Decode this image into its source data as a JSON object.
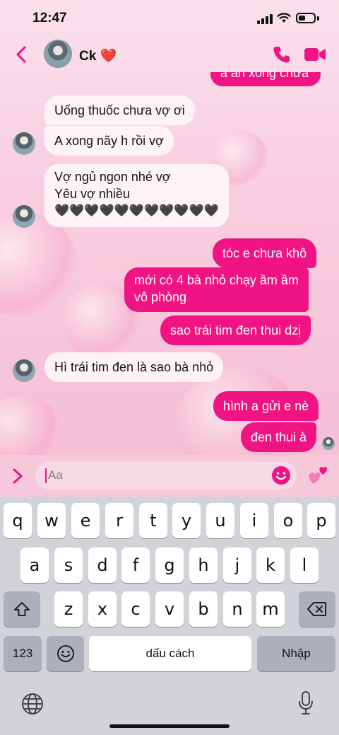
{
  "status_bar": {
    "time": "12:47"
  },
  "header": {
    "contact_name": "Ck ❤️"
  },
  "messages": [
    {
      "text": "a ăn xong chưa",
      "direction": "out"
    },
    {
      "text": "Uống thuốc chưa vợ ơi",
      "direction": "in"
    },
    {
      "text": "A xong nãy h rồi vợ",
      "direction": "in"
    },
    {
      "text": "Vợ ngủ ngon nhé vợ",
      "direction": "in"
    },
    {
      "text": "Yêu vợ nhiều",
      "direction": "in"
    },
    {
      "text": "🖤🖤🖤🖤🖤🖤🖤🖤🖤🖤🖤",
      "direction": "in"
    },
    {
      "text": "tóc e chưa khô",
      "direction": "out"
    },
    {
      "text": "mới có 4 bà nhỏ chạy ầm ầm",
      "direction": "out"
    },
    {
      "text": "vô phòng",
      "direction": "out"
    },
    {
      "text": "sao trái tim đen thui dzị",
      "direction": "out"
    },
    {
      "text": "Hì trái tim đen là sao bà nhỏ",
      "direction": "in"
    },
    {
      "text": "hình a gửi e nè",
      "direction": "out"
    },
    {
      "text": "đen thui à",
      "direction": "out"
    }
  ],
  "composer": {
    "placeholder": "Aa"
  },
  "keyboard": {
    "row1": [
      "q",
      "w",
      "e",
      "r",
      "t",
      "y",
      "u",
      "i",
      "o",
      "p"
    ],
    "row2": [
      "a",
      "s",
      "d",
      "f",
      "g",
      "h",
      "j",
      "k",
      "l"
    ],
    "row3": [
      "z",
      "x",
      "c",
      "v",
      "b",
      "n",
      "m"
    ],
    "numbers_label": "123",
    "space_label": "dấu cách",
    "return_label": "Nhập"
  },
  "colors": {
    "accent": "#f01383",
    "incoming_bubble": "#fdf3f4",
    "chat_background": "#f8cfe0",
    "keyboard_background": "#d1d3d9"
  },
  "icons": {
    "back": "chevron-left-icon",
    "call": "phone-icon",
    "video": "video-camera-icon",
    "expand": "chevron-right-icon",
    "emoji": "smiley-icon",
    "sticker": "two-hearts-icon",
    "shift": "shift-arrow-icon",
    "delete": "backspace-icon",
    "keyboard_emoji": "emoji-icon",
    "globe": "globe-icon",
    "mic": "microphone-icon"
  }
}
